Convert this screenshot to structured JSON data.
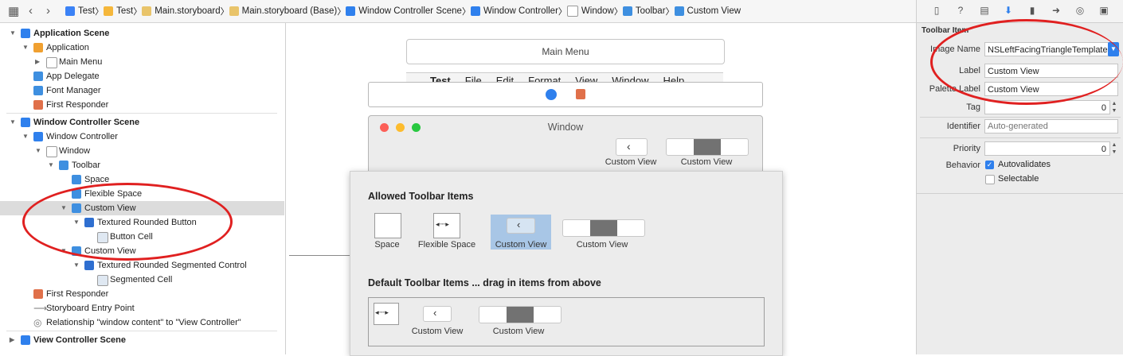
{
  "jumpbar": {
    "crumbs": [
      {
        "label": "Test",
        "icon": "swift-file-icon"
      },
      {
        "label": "Test",
        "icon": "folder-icon"
      },
      {
        "label": "Main.storyboard",
        "icon": "storyboard-icon"
      },
      {
        "label": "Main.storyboard (Base)",
        "icon": "storyboard-icon"
      },
      {
        "label": "Window Controller Scene",
        "icon": "scene-icon"
      },
      {
        "label": "Window Controller",
        "icon": "window-controller-icon"
      },
      {
        "label": "Window",
        "icon": "window-icon"
      },
      {
        "label": "Toolbar",
        "icon": "cube-icon"
      },
      {
        "label": "Custom View",
        "icon": "cube-icon"
      }
    ]
  },
  "outline": {
    "rows": [
      {
        "label": "Application Scene",
        "indent": 0,
        "tri": "▼",
        "icon": "scene-icon",
        "scene": true
      },
      {
        "label": "Application",
        "indent": 1,
        "tri": "▼",
        "icon": "application-icon"
      },
      {
        "label": "Main Menu",
        "indent": 2,
        "tri": "▶",
        "icon": "menu-icon"
      },
      {
        "label": "App Delegate",
        "indent": 1,
        "tri": "",
        "icon": "cube-icon"
      },
      {
        "label": "Font Manager",
        "indent": 1,
        "tri": "",
        "icon": "cube-icon"
      },
      {
        "label": "First Responder",
        "indent": 1,
        "tri": "",
        "icon": "first-responder-icon"
      },
      {
        "label": "Window Controller Scene",
        "indent": 0,
        "tri": "▼",
        "icon": "scene-icon",
        "scene": true
      },
      {
        "label": "Window Controller",
        "indent": 1,
        "tri": "▼",
        "icon": "window-controller-icon"
      },
      {
        "label": "Window",
        "indent": 2,
        "tri": "▼",
        "icon": "window-icon"
      },
      {
        "label": "Toolbar",
        "indent": 3,
        "tri": "▼",
        "icon": "cube-icon"
      },
      {
        "label": "Space",
        "indent": 4,
        "tri": "",
        "icon": "cube-icon"
      },
      {
        "label": "Flexible Space",
        "indent": 4,
        "tri": "",
        "icon": "cube-icon"
      },
      {
        "label": "Custom View",
        "indent": 4,
        "tri": "▼",
        "icon": "cube-icon",
        "selected": true
      },
      {
        "label": "Textured Rounded Button",
        "indent": 5,
        "tri": "▼",
        "icon": "button-icon"
      },
      {
        "label": "Button Cell",
        "indent": 6,
        "tri": "",
        "icon": "cell-icon"
      },
      {
        "label": "Custom View",
        "indent": 4,
        "tri": "▼",
        "icon": "cube-icon"
      },
      {
        "label": "Textured Rounded Segmented Control",
        "indent": 5,
        "tri": "▼",
        "icon": "button-icon"
      },
      {
        "label": "Segmented Cell",
        "indent": 6,
        "tri": "",
        "icon": "cell-icon"
      },
      {
        "label": "First Responder",
        "indent": 1,
        "tri": "",
        "icon": "first-responder-icon"
      },
      {
        "label": "Storyboard Entry Point",
        "indent": 1,
        "tri": "",
        "icon": "arrow-icon"
      },
      {
        "label": "Relationship \"window content\" to \"View Controller\"",
        "indent": 1,
        "tri": "",
        "icon": "relationship-icon"
      },
      {
        "label": "View Controller Scene",
        "indent": 0,
        "tri": "▶",
        "icon": "scene-icon",
        "scene": true
      }
    ]
  },
  "canvas": {
    "main_menu_title": "Main Menu",
    "menu_items": [
      "Test",
      "File",
      "Edit",
      "Format",
      "View",
      "Window",
      "Help"
    ],
    "window_title": "Window",
    "window_toolbar_captions": [
      "Custom View",
      "Custom View"
    ],
    "palette": {
      "allowed_title": "Allowed Toolbar Items",
      "allowed_items": [
        "Space",
        "Flexible Space",
        "Custom View",
        "Custom View"
      ],
      "default_title": "Default Toolbar Items ... drag in items from above",
      "default_items": [
        "Custom View",
        "Custom View"
      ]
    }
  },
  "inspector": {
    "section_title": "Toolbar Item",
    "image_name_label": "Image Name",
    "image_name_value": "NSLeftFacingTriangleTemplate",
    "label_label": "Label",
    "label_value": "Custom View",
    "palette_label_label": "Palette Label",
    "palette_label_value": "Custom View",
    "tag_label": "Tag",
    "tag_value": "0",
    "identifier_label": "Identifier",
    "identifier_placeholder": "Auto-generated",
    "priority_label": "Priority",
    "priority_value": "0",
    "behavior_label": "Behavior",
    "autovalidates_label": "Autovalidates",
    "autovalidates_checked": true,
    "selectable_label": "Selectable",
    "selectable_checked": false
  },
  "colors": {
    "annotation_red": "#e02020",
    "accent_blue": "#2f80ed",
    "selection_gray": "#dcdcdc"
  }
}
